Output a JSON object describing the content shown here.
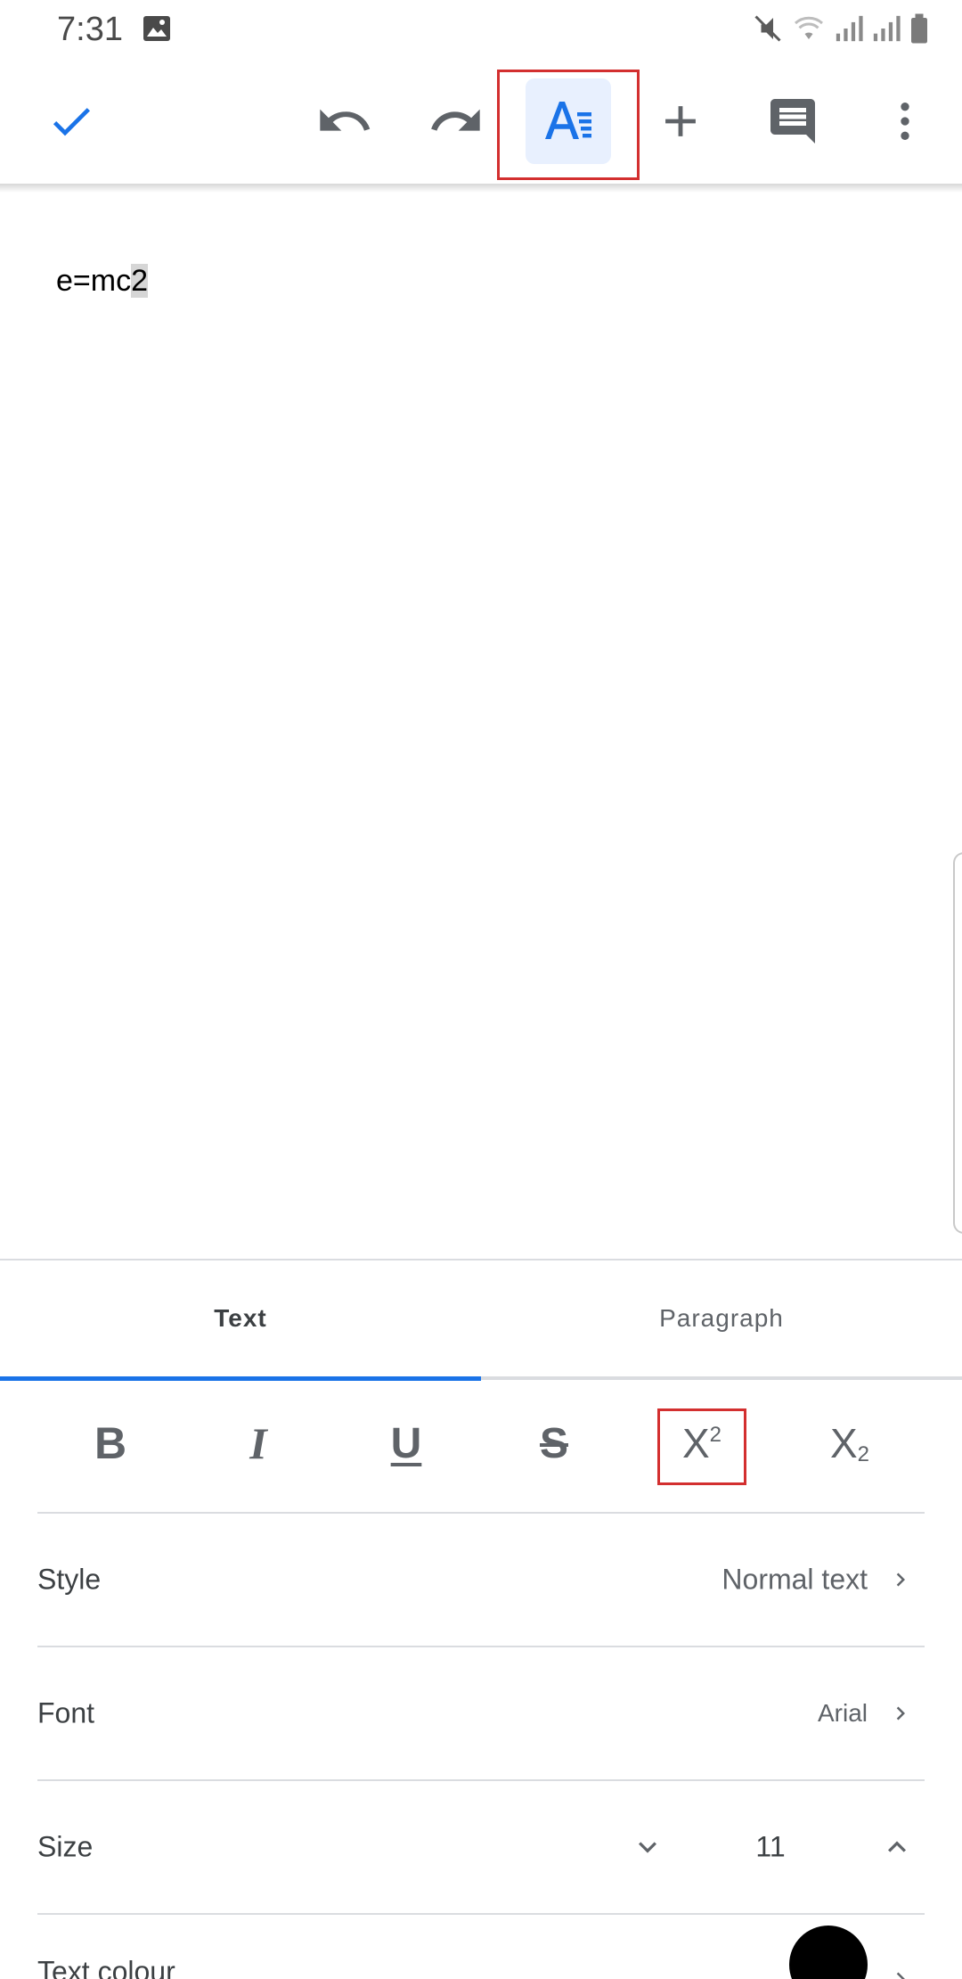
{
  "status_bar": {
    "time": "7:31",
    "icons": [
      "gallery-icon",
      "mute-icon",
      "wifi-icon",
      "signal-icon",
      "signal-icon",
      "battery-icon"
    ]
  },
  "toolbar": {
    "buttons": [
      "check-icon",
      "undo-icon",
      "redo-icon",
      "text-format-icon",
      "add-icon",
      "comment-icon",
      "more-vert-icon"
    ],
    "accent_color": "#1a73e8",
    "active_button_bg": "#e8f0fe"
  },
  "document": {
    "text_before": "e=mc",
    "text_selected": "2"
  },
  "format_panel": {
    "tabs": [
      {
        "label": "Text",
        "active": true
      },
      {
        "label": "Paragraph",
        "active": false
      }
    ],
    "format_buttons": [
      {
        "name": "bold",
        "glyph": "B"
      },
      {
        "name": "italic",
        "glyph": "I"
      },
      {
        "name": "underline",
        "glyph": "U"
      },
      {
        "name": "strikethrough",
        "glyph": "S"
      },
      {
        "name": "superscript",
        "glyph": "X",
        "sup": "2"
      },
      {
        "name": "subscript",
        "glyph": "X",
        "sub": "2"
      }
    ],
    "style": {
      "label": "Style",
      "value": "Normal text"
    },
    "font": {
      "label": "Font",
      "value": "Arial"
    },
    "size": {
      "label": "Size",
      "value": "11"
    },
    "text_colour": {
      "label": "Text colour",
      "color": "#000000"
    }
  },
  "highlight_color": "#d32f2f"
}
